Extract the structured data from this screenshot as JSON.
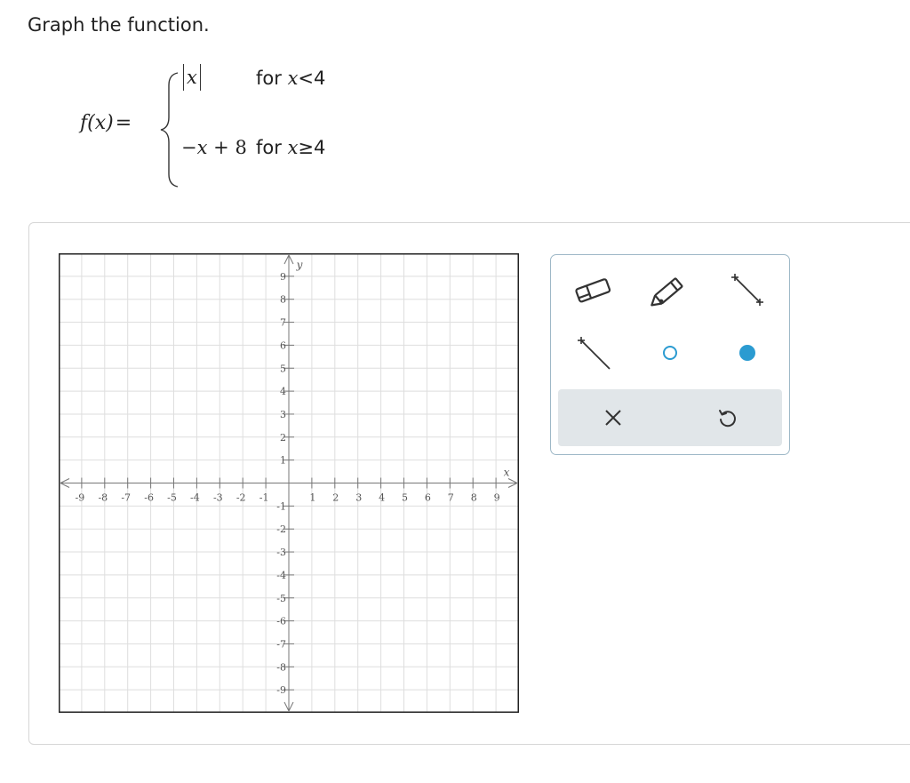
{
  "prompt": "Graph the function.",
  "function": {
    "name": "f",
    "variable": "x",
    "case1": {
      "expr_var": "x",
      "cond_word": "for",
      "cond_var": "x",
      "cond_op": "<",
      "cond_val": "4"
    },
    "case2": {
      "expr_minus": "−",
      "expr_var": "x",
      "expr_plus": "+",
      "expr_const": "8",
      "cond_word": "for",
      "cond_var": "x",
      "cond_op": "≥",
      "cond_val": "4"
    }
  },
  "graph": {
    "x_min": -10,
    "x_max": 10,
    "y_min": -10,
    "y_max": 10,
    "x_ticks": [
      -9,
      -8,
      -7,
      -6,
      -5,
      -4,
      -3,
      -2,
      -1,
      1,
      2,
      3,
      4,
      5,
      6,
      7,
      8,
      9
    ],
    "y_ticks": [
      9,
      8,
      7,
      6,
      5,
      4,
      3,
      2,
      1,
      -1,
      -2,
      -3,
      -4,
      -5,
      -6,
      -7,
      -8,
      -9
    ],
    "x_label": "x",
    "y_label": "y",
    "grid": true
  },
  "tools": [
    "eraser-icon",
    "pencil-icon",
    "line-segment-icon",
    "ray-icon",
    "open-circle-icon",
    "closed-point-icon"
  ],
  "actions": [
    "clear-icon",
    "undo-icon"
  ],
  "colors": {
    "accent": "#2b9bd1",
    "toolbox_border": "#9eb8c7",
    "action_bar": "#e1e6e9"
  }
}
